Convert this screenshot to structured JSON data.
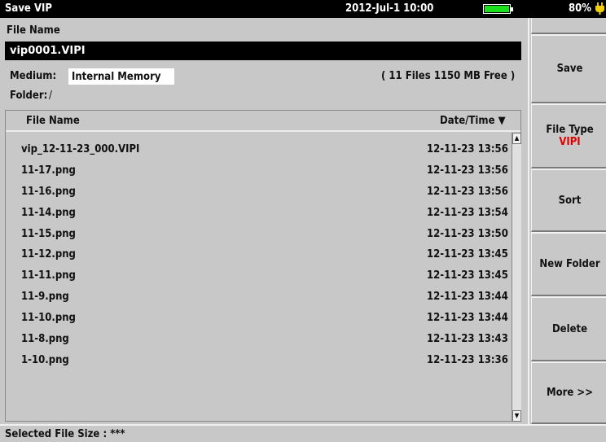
{
  "titlebar": {
    "title": "Save VIP",
    "datetime": "2012-Jul-1 10:00",
    "battery_percent": "80%",
    "battery_level": 1.0,
    "battery_color": "#1ee11e"
  },
  "form": {
    "file_name_label": "File Name",
    "file_name_value": "vip0001.VIPI",
    "medium_label": "Medium:",
    "medium_value": "Internal Memory",
    "folder_label": "Folder:",
    "folder_value": "/",
    "storage_info": "( 11 Files   1150 MB Free )"
  },
  "list": {
    "col_name": "File Name",
    "col_date": "Date/Time ▼",
    "rows": [
      {
        "name": "vip_12-11-23_000.VIPI",
        "date": "12-11-23 13:56"
      },
      {
        "name": "11-17.png",
        "date": "12-11-23 13:56"
      },
      {
        "name": "11-16.png",
        "date": "12-11-23 13:56"
      },
      {
        "name": "11-14.png",
        "date": "12-11-23 13:54"
      },
      {
        "name": "11-15.png",
        "date": "12-11-23 13:50"
      },
      {
        "name": "11-12.png",
        "date": "12-11-23 13:45"
      },
      {
        "name": "11-11.png",
        "date": "12-11-23 13:45"
      },
      {
        "name": "11-9.png",
        "date": "12-11-23 13:44"
      },
      {
        "name": "11-10.png",
        "date": "12-11-23 13:44"
      },
      {
        "name": "11-8.png",
        "date": "12-11-23 13:43"
      },
      {
        "name": "1-10.png",
        "date": "12-11-23 13:36"
      }
    ]
  },
  "status": {
    "text": "Selected File Size : ***"
  },
  "softkeys": {
    "save": "Save",
    "file_type": "File Type",
    "file_type_value": "VIPI",
    "sort": "Sort",
    "new_folder": "New Folder",
    "delete": "Delete",
    "more": "More >>"
  },
  "icons": {
    "scroll_up": "scroll-up-arrow-icon",
    "scroll_down": "scroll-down-arrow-icon",
    "battery": "battery-icon",
    "plug": "power-plug-icon"
  }
}
